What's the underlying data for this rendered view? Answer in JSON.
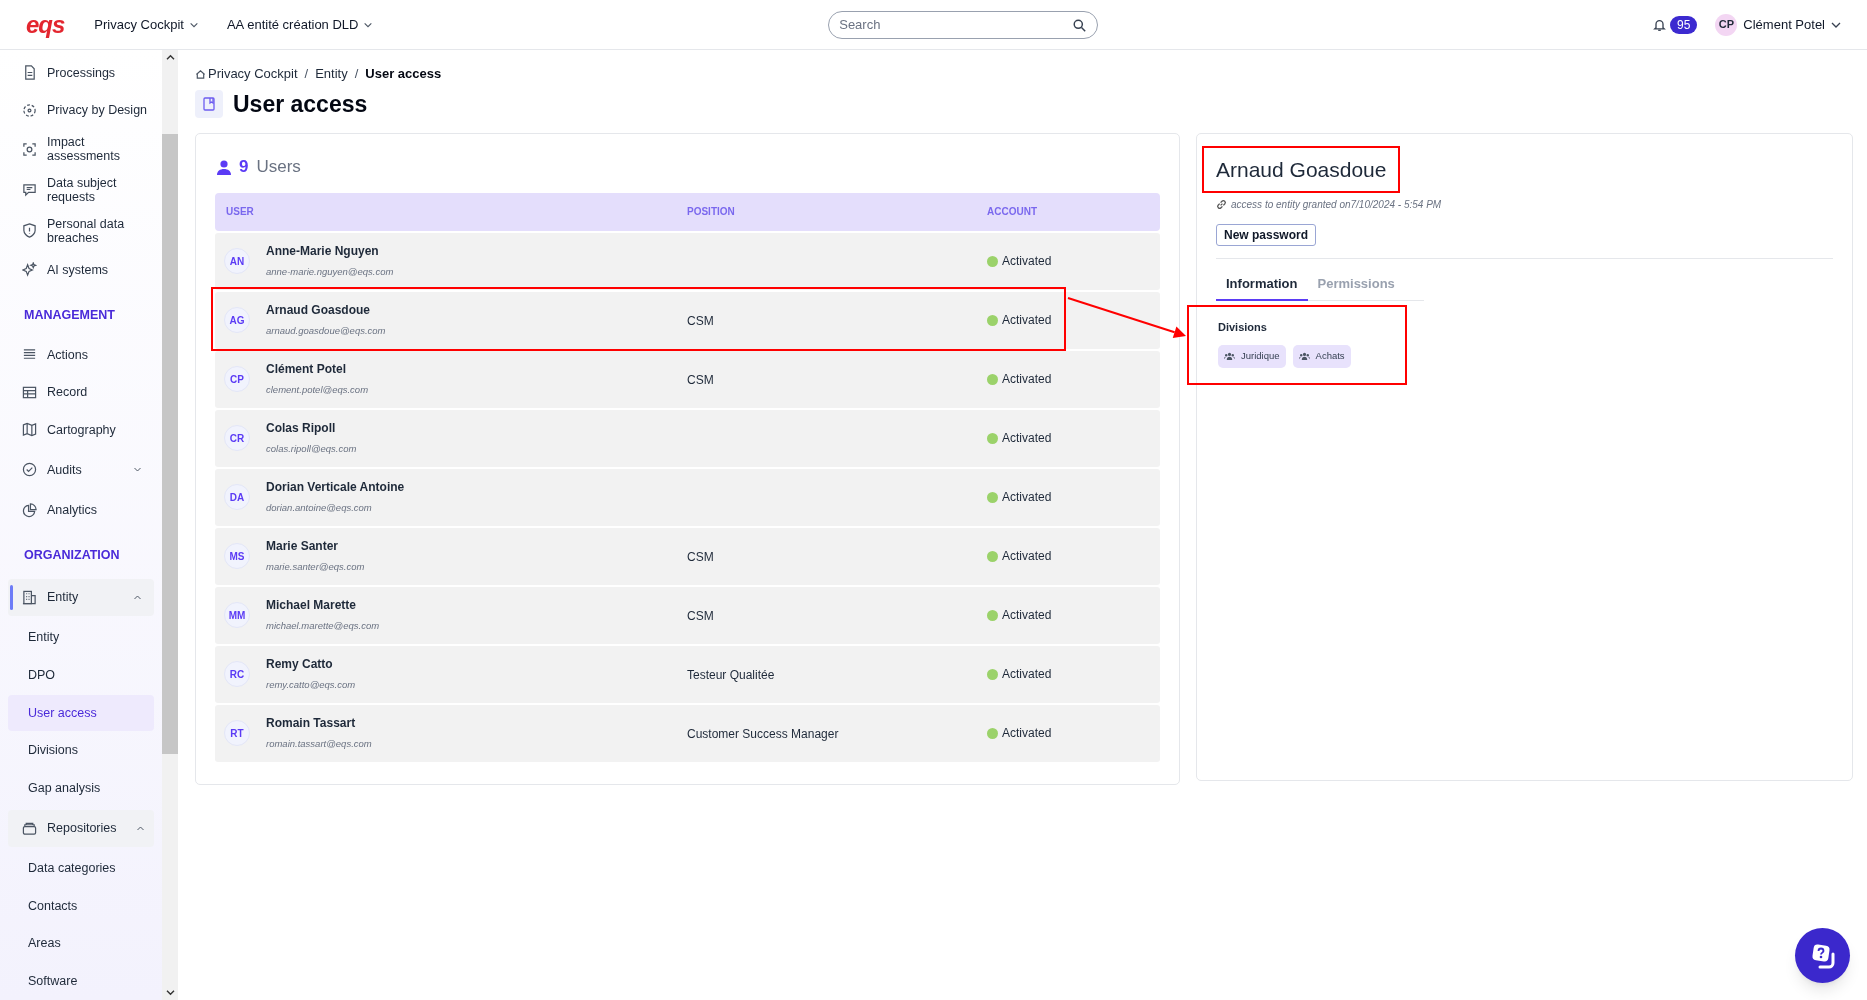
{
  "header": {
    "logo": "eqs",
    "menus": [
      {
        "label": "Privacy Cockpit"
      },
      {
        "label": "AA entité création DLD"
      }
    ],
    "search": {
      "placeholder": "Search"
    },
    "notifications": "95",
    "user": {
      "initials": "CP",
      "name": "Clément Potel"
    }
  },
  "sidebar": {
    "items": [
      {
        "kind": "link",
        "label": "Processings",
        "selected": false
      },
      {
        "kind": "link",
        "label": "Privacy by Design",
        "selected": false
      },
      {
        "kind": "link",
        "label": "Impact assessments",
        "selected": false
      },
      {
        "kind": "link",
        "label": "Data subject requests",
        "selected": false
      },
      {
        "kind": "link",
        "label": "Personal data breaches",
        "selected": false
      },
      {
        "kind": "link",
        "label": "AI systems",
        "selected": false
      },
      {
        "kind": "heading",
        "label": "MANAGEMENT"
      },
      {
        "kind": "link",
        "label": "Actions",
        "selected": false
      },
      {
        "kind": "link",
        "label": "Record",
        "selected": false
      },
      {
        "kind": "link",
        "label": "Cartography",
        "selected": false
      },
      {
        "kind": "group",
        "label": "Audits",
        "selected": false,
        "expanded": false
      },
      {
        "kind": "link",
        "label": "Analytics",
        "selected": false
      },
      {
        "kind": "heading",
        "label": "ORGANIZATION"
      },
      {
        "kind": "group",
        "label": "Entity",
        "selected": true,
        "expanded": true,
        "children": [
          {
            "label": "Entity",
            "selected": false
          },
          {
            "label": "DPO",
            "selected": false
          },
          {
            "label": "User access",
            "selected": true
          },
          {
            "label": "Divisions",
            "selected": false
          },
          {
            "label": "Gap analysis",
            "selected": false
          }
        ]
      },
      {
        "kind": "group",
        "label": "Repositories",
        "selected": false,
        "expanded": true,
        "children": [
          {
            "label": "Data categories",
            "selected": false
          },
          {
            "label": "Contacts",
            "selected": false
          },
          {
            "label": "Areas",
            "selected": false
          },
          {
            "label": "Software",
            "selected": false
          }
        ]
      }
    ]
  },
  "breadcrumb": [
    {
      "kind": "link",
      "label": "Privacy Cockpit"
    },
    {
      "kind": "separator",
      "label": "/"
    },
    {
      "kind": "link",
      "label": "Entity"
    },
    {
      "kind": "separator",
      "label": "/"
    },
    {
      "kind": "current",
      "label": "User access"
    }
  ],
  "title": "User access",
  "users": {
    "count": "9",
    "label": "Users",
    "columns": [
      "USER",
      "POSITION",
      "ACCOUNT"
    ],
    "rows": [
      {
        "initials": "AN",
        "name": "Anne-Marie Nguyen",
        "email": "anne-marie.nguyen@eqs.com",
        "position": "",
        "account": "Activated",
        "active": true,
        "highlighted": false
      },
      {
        "initials": "AG",
        "name": "Arnaud Goasdoue",
        "email": "arnaud.goasdoue@eqs.com",
        "position": "CSM",
        "account": "Activated",
        "active": true,
        "highlighted": true
      },
      {
        "initials": "CP",
        "name": "Clément Potel",
        "email": "clement.potel@eqs.com",
        "position": "CSM",
        "account": "Activated",
        "active": true,
        "highlighted": false
      },
      {
        "initials": "CR",
        "name": "Colas Ripoll",
        "email": "colas.ripoll@eqs.com",
        "position": "",
        "account": "Activated",
        "active": true,
        "highlighted": false
      },
      {
        "initials": "DA",
        "name": "Dorian Verticale Antoine",
        "email": "dorian.antoine@eqs.com",
        "position": "",
        "account": "Activated",
        "active": true,
        "highlighted": false
      },
      {
        "initials": "MS",
        "name": "Marie Santer",
        "email": "marie.santer@eqs.com",
        "position": "CSM",
        "account": "Activated",
        "active": true,
        "highlighted": false
      },
      {
        "initials": "MM",
        "name": "Michael Marette",
        "email": "michael.marette@eqs.com",
        "position": "CSM",
        "account": "Activated",
        "active": true,
        "highlighted": false
      },
      {
        "initials": "RC",
        "name": "Remy Catto",
        "email": "remy.catto@eqs.com",
        "position": "Testeur Qualitée",
        "account": "Activated",
        "active": true,
        "highlighted": false
      },
      {
        "initials": "RT",
        "name": "Romain Tassart",
        "email": "romain.tassart@eqs.com",
        "position": "Customer Success Manager",
        "account": "Activated",
        "active": true,
        "highlighted": false
      }
    ]
  },
  "detail": {
    "name": "Arnaud Goasdoue",
    "name_highlighted": true,
    "access_note": "access to entity granted on7/10/2024 - 5:54 PM",
    "button": "New password",
    "tabs": [
      {
        "label": "Information",
        "selected": true
      },
      {
        "label": "Permissions",
        "selected": false
      }
    ],
    "divisions": {
      "label": "Divisions",
      "highlighted": true,
      "chips": [
        "Juridique",
        "Achats"
      ]
    }
  }
}
